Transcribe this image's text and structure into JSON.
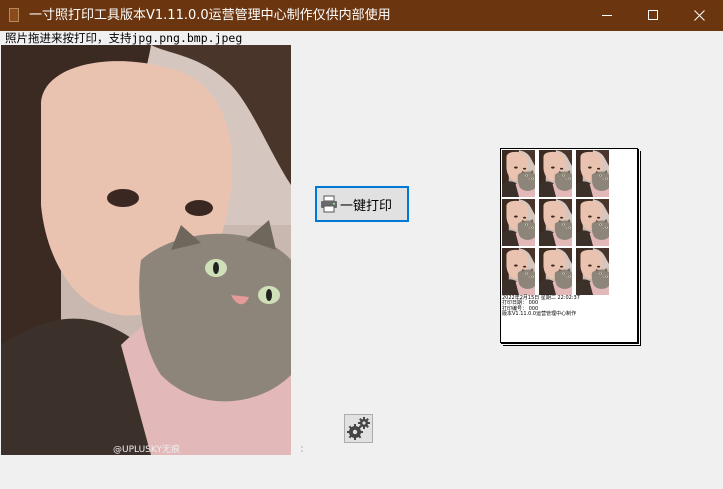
{
  "window": {
    "title": "一寸照打印工具版本V1.11.0.0运营管理中心制作仅供内部使用",
    "controls": {
      "minimize": "minimize-icon",
      "maximize": "maximize-icon",
      "close": "close-icon"
    }
  },
  "drop_label": "照片拖进来按打印，支持jpg.png.bmp.jpeg",
  "photo": {
    "watermark": "@UPLUSKY无痕"
  },
  "print_button": {
    "label": "一键打印",
    "icon": "printer-icon"
  },
  "preview": {
    "rows": 3,
    "cols": 3,
    "info_lines": [
      "2022年2月15日 星期二 22:02:37",
      "打印日期：  000",
      "打印编号：  000",
      "版本V1.11.0.0运营管理中心制作"
    ]
  },
  "settings_button": {
    "icon": "gears-icon"
  },
  "colors": {
    "titlebar": "#6b360f",
    "focus_border": "#0078d7",
    "window_bg": "#f0f0f0"
  }
}
